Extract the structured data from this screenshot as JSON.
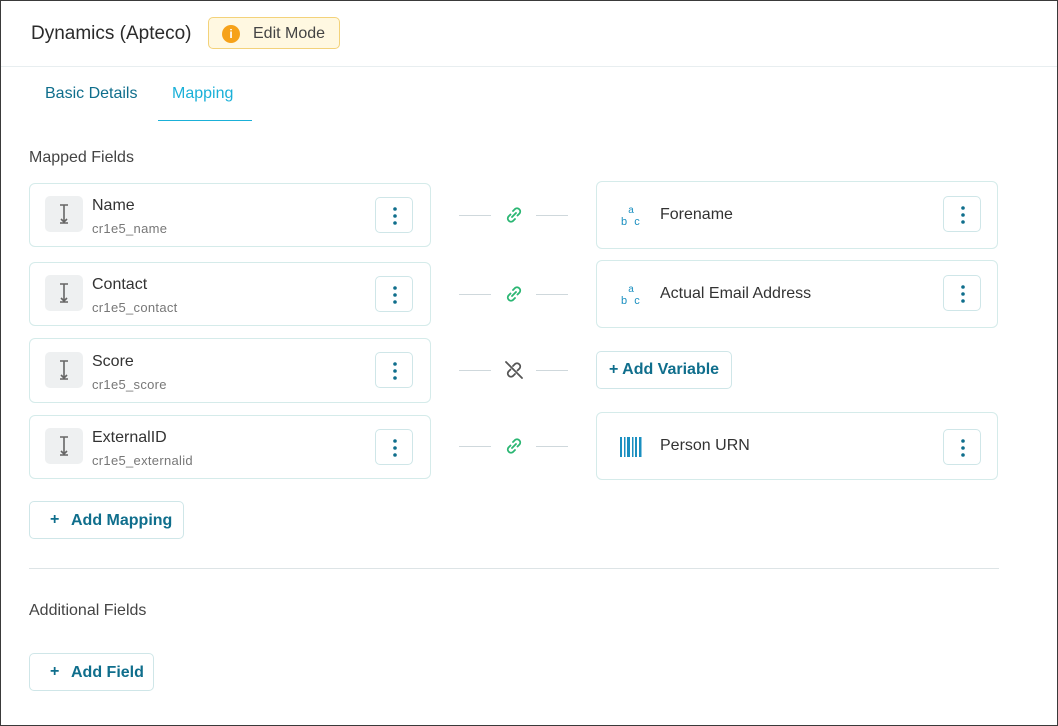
{
  "header": {
    "title": "Dynamics (Apteco)",
    "badge_icon": "info-icon",
    "badge_icon_glyph": "i",
    "badge_label": "Edit Mode"
  },
  "tabs": [
    {
      "label": "Basic Details",
      "active": false
    },
    {
      "label": "Mapping",
      "active": true
    }
  ],
  "mapped_section": {
    "title": "Mapped Fields",
    "rows": [
      {
        "field_name": "Name",
        "field_id": "cr1e5_name",
        "linked": true,
        "variable": {
          "type": "text",
          "label": "Forename",
          "icon_glyph": "abc"
        }
      },
      {
        "field_name": "Contact",
        "field_id": "cr1e5_contact",
        "linked": true,
        "variable": {
          "type": "text",
          "label": "Actual Email Address",
          "icon_glyph": "abc"
        }
      },
      {
        "field_name": "Score",
        "field_id": "cr1e5_score",
        "linked": false,
        "variable": null,
        "add_variable_label": "+ Add Variable"
      },
      {
        "field_name": "ExternalID",
        "field_id": "cr1e5_externalid",
        "linked": true,
        "variable": {
          "type": "reference",
          "label": "Person URN"
        }
      }
    ],
    "add_mapping_icon": "+",
    "add_mapping_label": "Add Mapping"
  },
  "additional_section": {
    "title": "Additional Fields",
    "add_field_icon": "+",
    "add_field_label": "Add Field"
  },
  "colors": {
    "accent": "#0f6e8c",
    "tab_active": "#1ab0d8",
    "link_green": "#2bb673",
    "badge_bg": "#fff8e1",
    "badge_icon": "#f6a21a"
  }
}
